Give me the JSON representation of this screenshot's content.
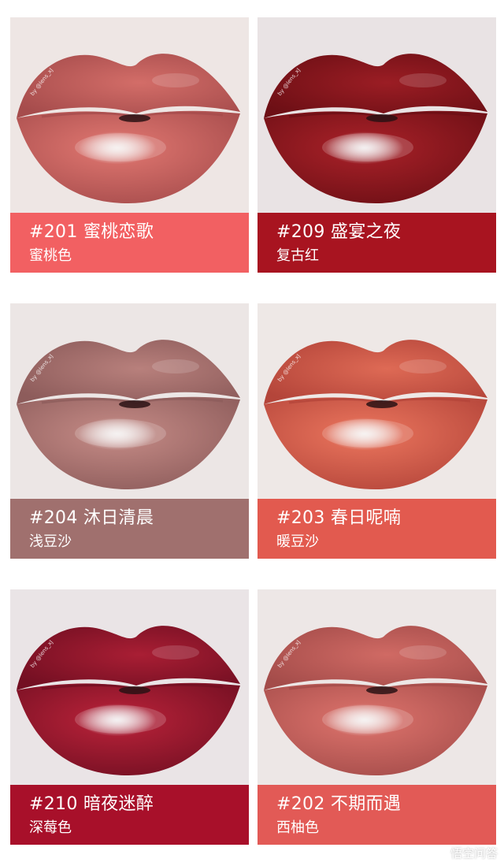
{
  "cards": [
    {
      "name": "#201 蜜桃恋歌",
      "desc": "蜜桃色",
      "bar_color": "#f26062",
      "lip_color": "#d36d68",
      "lip_shadow": "#a64c4c",
      "bg": "#eee6e4"
    },
    {
      "name": "#209 盛宴之夜",
      "desc": "复古红",
      "bar_color": "#a81420",
      "lip_color": "#9b1d24",
      "lip_shadow": "#6d0f15",
      "bg": "#e9e3e4"
    },
    {
      "name": "#204 沐日清晨",
      "desc": "浅豆沙",
      "bar_color": "#a0706e",
      "lip_color": "#b8807c",
      "lip_shadow": "#8d5c5b",
      "bg": "#ece6e5"
    },
    {
      "name": "#203 春日呢喃",
      "desc": "暖豆沙",
      "bar_color": "#e25a4f",
      "lip_color": "#de6a55",
      "lip_shadow": "#b4453a",
      "bg": "#eee8e6"
    },
    {
      "name": "#210 暗夜迷醉",
      "desc": "深莓色",
      "bar_color": "#a8102a",
      "lip_color": "#a91e34",
      "lip_shadow": "#730f22",
      "bg": "#eae4e6"
    },
    {
      "name": "#202 不期而遇",
      "desc": "西柚色",
      "bar_color": "#e25a56",
      "lip_color": "#d06a64",
      "lip_shadow": "#a44c4a",
      "bg": "#ede7e6"
    }
  ],
  "watermark": "by @lens_xJ",
  "footer": {
    "brand": "悟空问答",
    "icon": "wukong-logo-icon"
  }
}
